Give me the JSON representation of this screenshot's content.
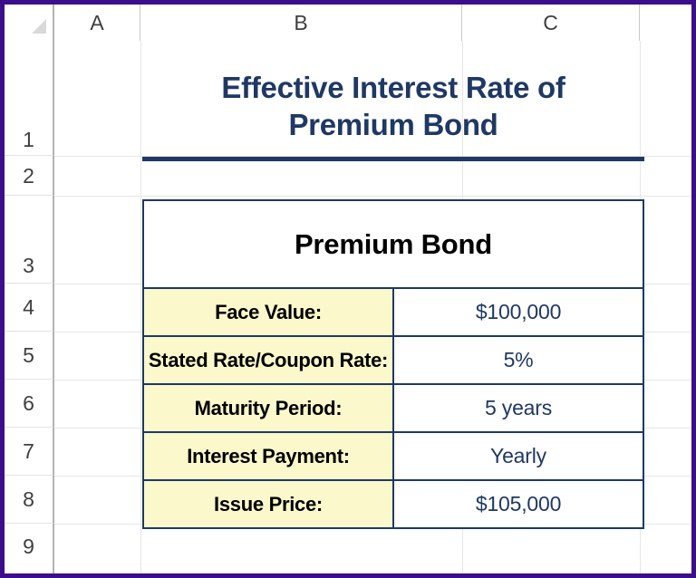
{
  "window": {
    "frame_color": "#3b0e8c",
    "background": "#ffffff"
  },
  "spreadsheet": {
    "select_all_corner": "select-all-corner",
    "column_headers": [
      {
        "label": "A"
      },
      {
        "label": "B"
      },
      {
        "label": "C"
      },
      {
        "label": ""
      }
    ],
    "row_headers": [
      {
        "label": "1"
      },
      {
        "label": "2"
      },
      {
        "label": "3"
      },
      {
        "label": "4"
      },
      {
        "label": "5"
      },
      {
        "label": "6"
      },
      {
        "label": "7"
      },
      {
        "label": "8"
      },
      {
        "label": "9"
      }
    ]
  },
  "title": {
    "line1": "Effective Interest Rate of",
    "line2": "Premium Bond",
    "full_text": "Effective Interest Rate of Premium Bond",
    "color": "#1f3864",
    "rule_color": "#1f3864"
  },
  "table": {
    "header": "Premium Bond",
    "header_color": "#000000",
    "border_color": "#1f3864",
    "label_fill": "#fbf8cb",
    "value_fill": "#ffffff",
    "value_color": "#1f3864",
    "rows": [
      {
        "label": "Face Value:",
        "value": "$100,000"
      },
      {
        "label": "Stated Rate/Coupon Rate:",
        "value": "5%"
      },
      {
        "label": "Maturity Period:",
        "value": "5 years"
      },
      {
        "label": "Interest Payment:",
        "value": "Yearly"
      },
      {
        "label": "Issue Price:",
        "value": "$105,000"
      }
    ]
  }
}
